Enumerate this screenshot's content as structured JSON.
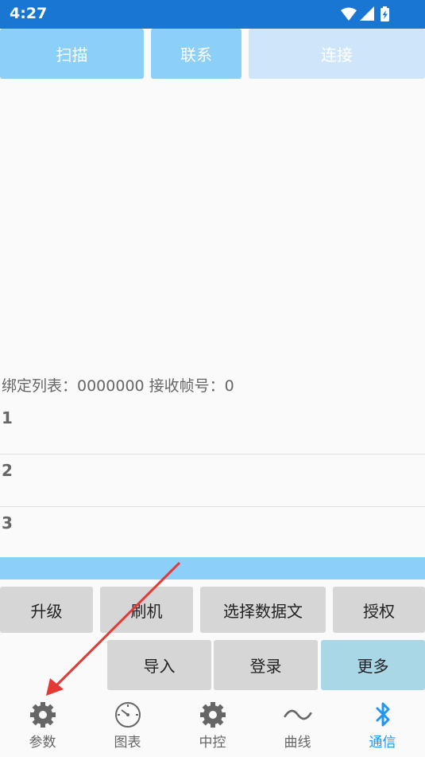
{
  "status_bar": {
    "time": "4:27"
  },
  "top_buttons": {
    "scan": "扫描",
    "contact": "联系",
    "connect": "连接"
  },
  "info": {
    "text": "绑定列表：0000000  接收帧号：0"
  },
  "rows": [
    {
      "label": "1"
    },
    {
      "label": "2"
    },
    {
      "label": "3"
    }
  ],
  "actions": {
    "upgrade": "升级",
    "flash": "刷机",
    "select_data_file": "选择数据文",
    "authorize": "授权",
    "import": "导入",
    "login": "登录",
    "more": "更多"
  },
  "nav": {
    "items": [
      {
        "label": "参数",
        "icon": "gear-icon"
      },
      {
        "label": "图表",
        "icon": "gauge-icon"
      },
      {
        "label": "中控",
        "icon": "gear-icon"
      },
      {
        "label": "曲线",
        "icon": "wave-icon"
      },
      {
        "label": "通信",
        "icon": "bluetooth-icon"
      }
    ],
    "active_index": 4
  },
  "colors": {
    "status_bar": "#1976d2",
    "top_button": "#8ccff8",
    "top_button_disabled": "#cfe6fa",
    "grey_button": "#d6d6d6",
    "more_button": "#a9d7e6",
    "active_nav": "#2196f3",
    "annotation_arrow": "#e53935"
  }
}
